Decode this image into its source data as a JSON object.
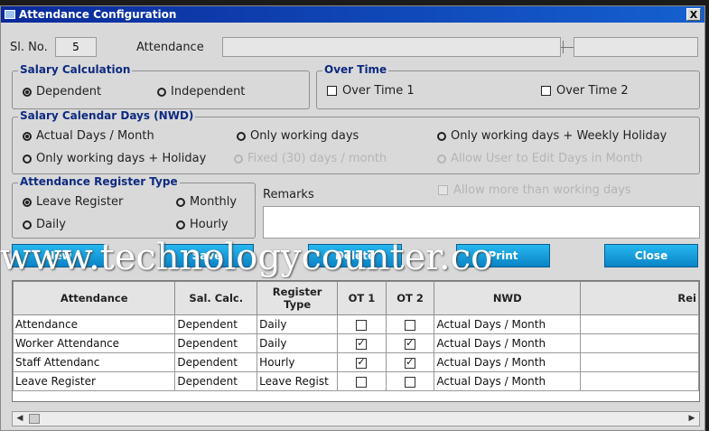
{
  "window": {
    "title": "Attendance Configuration",
    "close_label": "X"
  },
  "header": {
    "slno_label": "Sl. No.",
    "slno_value": "5",
    "attendance_label": "Attendance",
    "attendance_value": "",
    "extra_value": ""
  },
  "salary_calculation": {
    "title": "Salary Calculation",
    "options": [
      {
        "label": "Dependent",
        "selected": true
      },
      {
        "label": "Independent",
        "selected": false
      }
    ]
  },
  "over_time": {
    "title": "Over Time",
    "options": [
      {
        "label": "Over Time 1",
        "checked": false
      },
      {
        "label": "Over Time 2",
        "checked": false
      }
    ]
  },
  "salary_calendar": {
    "title": "Salary Calendar Days (NWD)",
    "options": [
      {
        "label": "Actual Days / Month",
        "selected": true,
        "disabled": false
      },
      {
        "label": "Only working days",
        "selected": false,
        "disabled": false
      },
      {
        "label": "Only working days + Weekly Holiday",
        "selected": false,
        "disabled": false
      },
      {
        "label": "Only working days + Holiday",
        "selected": false,
        "disabled": false
      },
      {
        "label": "Fixed (30) days / month",
        "selected": false,
        "disabled": true
      },
      {
        "label": "Allow User to Edit Days in Month",
        "selected": false,
        "disabled": true
      }
    ]
  },
  "register_type": {
    "title": "Attendance Register Type",
    "options": [
      {
        "label": "Leave Register",
        "selected": true
      },
      {
        "label": "Monthly",
        "selected": false
      },
      {
        "label": "Daily",
        "selected": false
      },
      {
        "label": "Hourly",
        "selected": false
      }
    ]
  },
  "allow_more_label": "Allow more than working days",
  "remarks": {
    "label": "Remarks",
    "value": ""
  },
  "buttons": {
    "new": "New",
    "save": "Save",
    "delete": "Delete",
    "print": "Print",
    "close": "Close"
  },
  "watermark": "www.technologycounter.co",
  "grid": {
    "columns": [
      "Attendance",
      "Sal. Calc.",
      "Register Type",
      "OT 1",
      "OT 2",
      "NWD",
      "Rei"
    ],
    "rows": [
      {
        "attendance": "Attendance",
        "sal_calc": "Dependent",
        "register": "Daily",
        "ot1": false,
        "ot2": false,
        "nwd": "Actual Days / Month",
        "remarks": ""
      },
      {
        "attendance": "Worker Attendance",
        "sal_calc": "Dependent",
        "register": "Daily",
        "ot1": true,
        "ot2": true,
        "nwd": "Actual Days / Month",
        "remarks": ""
      },
      {
        "attendance": "Staff Attendanc",
        "sal_calc": "Dependent",
        "register": "Hourly",
        "ot1": true,
        "ot2": true,
        "nwd": "Actual Days / Month",
        "remarks": ""
      },
      {
        "attendance": "Leave Register",
        "sal_calc": "Dependent",
        "register": "Leave Regist",
        "ot1": false,
        "ot2": false,
        "nwd": "Actual Days / Month",
        "remarks": ""
      }
    ]
  },
  "colors": {
    "title_start": "#0a2a9a",
    "title_end": "#1560d0",
    "legend_text": "#0d2a80",
    "button": "#0a83c6"
  }
}
